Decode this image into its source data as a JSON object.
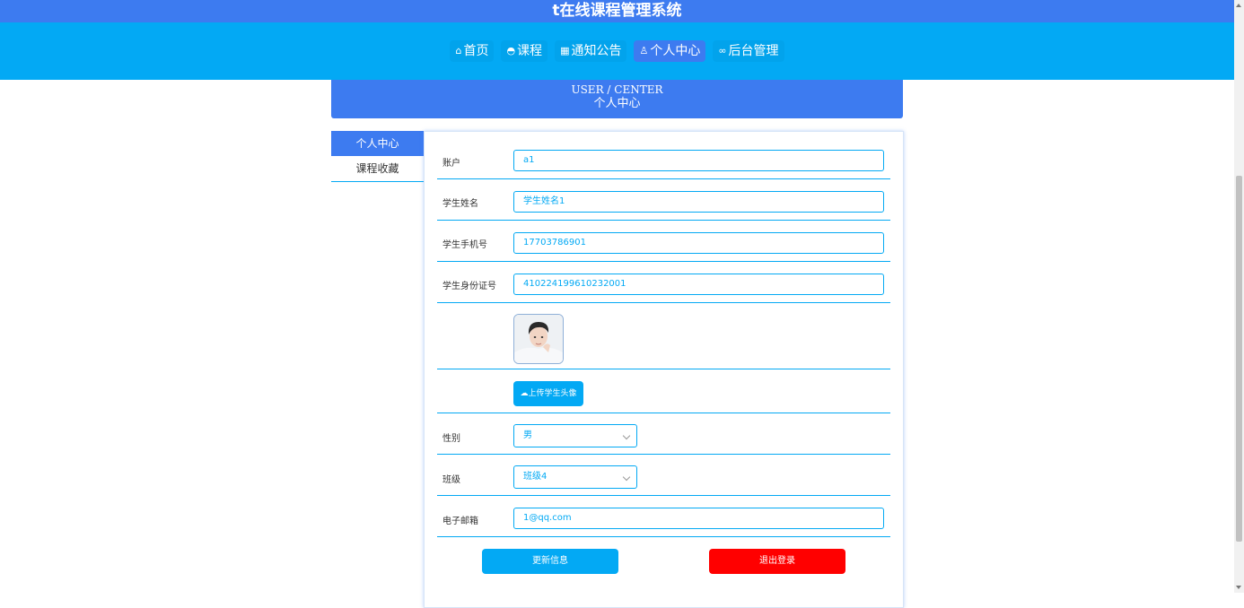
{
  "app_title": "t在线课程管理系统",
  "nav": {
    "items": [
      {
        "icon": "home-icon",
        "glyph": "⌂",
        "label": "首页",
        "active": false
      },
      {
        "icon": "course-icon",
        "glyph": "◓",
        "label": "课程",
        "active": false
      },
      {
        "icon": "notice-icon",
        "glyph": "▦",
        "label": "通知公告",
        "active": false
      },
      {
        "icon": "user-icon",
        "glyph": "♙",
        "label": "个人中心",
        "active": true
      },
      {
        "icon": "link-icon",
        "glyph": "∞",
        "label": "后台管理",
        "active": false
      }
    ]
  },
  "banner": {
    "en": "USER / CENTER",
    "cn": "个人中心"
  },
  "side_menu": {
    "items": [
      {
        "label": "个人中心",
        "active": true
      },
      {
        "label": "课程收藏",
        "active": false
      }
    ]
  },
  "form": {
    "account": {
      "label": "账户",
      "value": "a1"
    },
    "name": {
      "label": "学生姓名",
      "value": "学生姓名1"
    },
    "phone": {
      "label": "学生手机号",
      "value": "17703786901"
    },
    "idcard": {
      "label": "学生身份证号",
      "value": "410224199610232001"
    },
    "upload_label": "上传学生头像",
    "gender": {
      "label": "性别",
      "value": "男"
    },
    "class": {
      "label": "班级",
      "value": "班级4"
    },
    "email": {
      "label": "电子邮箱",
      "value": "1@qq.com"
    },
    "update_label": "更新信息",
    "logout_label": "退出登录"
  },
  "colors": {
    "primary": "#3d7bf0",
    "accent": "#03a9f4",
    "danger": "#ff0000"
  }
}
